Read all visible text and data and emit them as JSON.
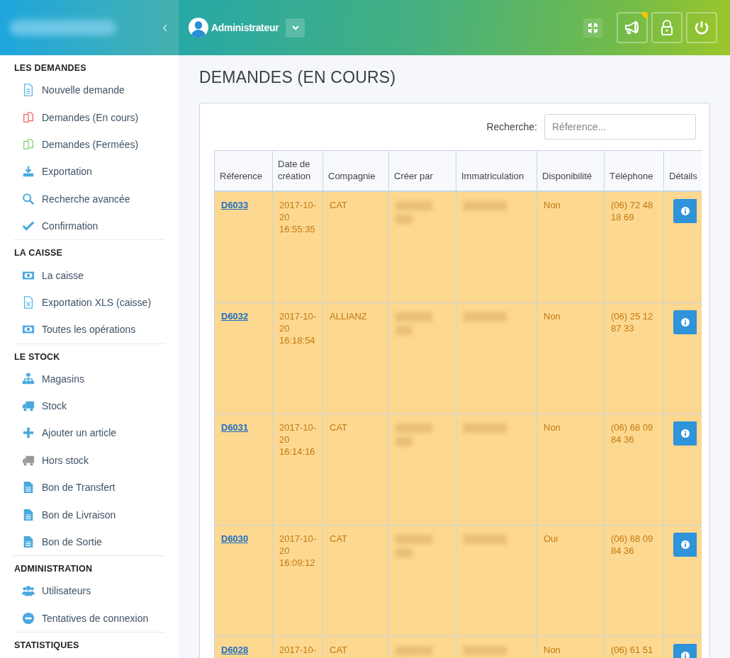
{
  "header": {
    "user": "Administrateur"
  },
  "sidebar": {
    "sections": [
      {
        "title": "LES DEMANDES",
        "items": [
          {
            "label": "Nouvelle demande",
            "kind": "file-outline",
            "color": "#5bb8e8"
          },
          {
            "label": "Demandes (En cours)",
            "kind": "copy",
            "color": "#f06a6a"
          },
          {
            "label": "Demandes (Fermées)",
            "kind": "copy",
            "color": "#8ad27a"
          },
          {
            "label": "Exportation",
            "kind": "download",
            "color": "#4aa8de"
          },
          {
            "label": "Recherche avancée",
            "kind": "search",
            "color": "#4aa8de"
          },
          {
            "label": "Confirmation",
            "kind": "check",
            "color": "#4aa8de"
          }
        ]
      },
      {
        "title": "LA CAISSE",
        "items": [
          {
            "label": "La caisse",
            "kind": "money",
            "color": "#4aa8de"
          },
          {
            "label": "Exportation XLS (caisse)",
            "kind": "xls",
            "color": "#5bb8e8"
          },
          {
            "label": "Toutes les opérations",
            "kind": "money",
            "color": "#4aa8de"
          }
        ]
      },
      {
        "title": "LE STOCK",
        "items": [
          {
            "label": "Magasins",
            "kind": "sitemap",
            "color": "#4aa8de"
          },
          {
            "label": "Stock",
            "kind": "truck",
            "color": "#4aa8de"
          },
          {
            "label": "Ajouter un article",
            "kind": "plus",
            "color": "#4aa8de"
          },
          {
            "label": "Hors stock",
            "kind": "truck",
            "color": "#999999"
          },
          {
            "label": "Bon de Transfert",
            "kind": "file",
            "color": "#4aa8de"
          },
          {
            "label": "Bon de Livraison",
            "kind": "file",
            "color": "#4aa8de"
          },
          {
            "label": "Bon de Sortie",
            "kind": "file",
            "color": "#4aa8de"
          }
        ]
      },
      {
        "title": "ADMINISTRATION",
        "items": [
          {
            "label": "Utilisateurs",
            "kind": "users",
            "color": "#4aa8de"
          },
          {
            "label": "Tentatives de connexion",
            "kind": "minus",
            "color": "#4aa8de"
          }
        ]
      },
      {
        "title": "STATISTIQUES"
      }
    ]
  },
  "page": {
    "title": "DEMANDES (EN COURS)",
    "search": {
      "label": "Recherche:",
      "placeholder": "Réference..."
    },
    "table": {
      "columns": [
        "Réference",
        "Date de création",
        "Compagnie",
        "Créer par",
        "Immatriculation",
        "Disponibilité",
        "Téléphone",
        "Détails"
      ],
      "rows": [
        {
          "reference": "D6033",
          "date": "2017-10-20 16:55:35",
          "compagnie": "CAT",
          "disponibilite": "Non",
          "telephone": "(06) 72 48 18 69"
        },
        {
          "reference": "D6032",
          "date": "2017-10-20 16:18:54",
          "compagnie": "ALLIANZ",
          "disponibilite": "Non",
          "telephone": "(06) 25 12 87 33"
        },
        {
          "reference": "D6031",
          "date": "2017-10-20 16:14:16",
          "compagnie": "CAT",
          "disponibilite": "Non",
          "telephone": "(06) 68 09 84 36"
        },
        {
          "reference": "D6030",
          "date": "2017-10-20 16:09:12",
          "compagnie": "CAT",
          "disponibilite": "Oui",
          "telephone": "(06) 68 09 84 36"
        },
        {
          "reference": "D6028",
          "date": "2017-10-",
          "compagnie": "CAT",
          "disponibilite": "Non",
          "telephone": "(06) 61 51"
        }
      ]
    }
  }
}
